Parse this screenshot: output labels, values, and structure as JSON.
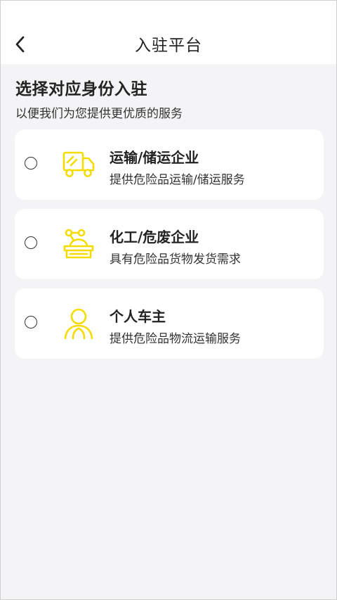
{
  "nav": {
    "back_icon": "chevron-left-icon",
    "title": "入驻平台"
  },
  "intro": {
    "heading": "选择对应身份入驻",
    "subheading": "以便我们为您提供更优质的服务"
  },
  "accent_color": "#f5dc00",
  "options": [
    {
      "icon": "truck-icon",
      "title": "运输/储运企业",
      "description": "提供危险品运输/储运服务",
      "selected": false
    },
    {
      "icon": "chemical-icon",
      "title": "化工/危废企业",
      "description": "具有危险品货物发货需求",
      "selected": false
    },
    {
      "icon": "person-icon",
      "title": "个人车主",
      "description": "提供危险品物流运输服务",
      "selected": false
    }
  ]
}
